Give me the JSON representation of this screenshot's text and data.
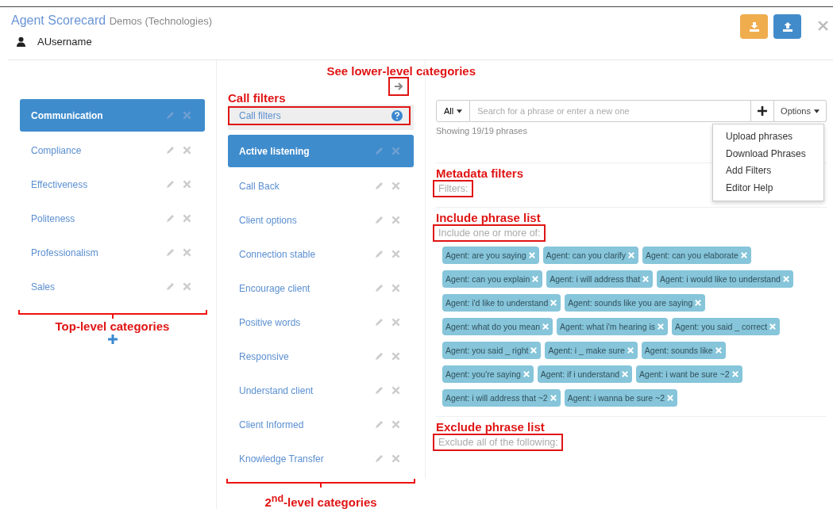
{
  "header": {
    "title": "Agent Scorecard",
    "subtitle": "Demos (Technologies)",
    "user": "AUsername"
  },
  "top_categories": [
    {
      "label": "Communication",
      "selected": true
    },
    {
      "label": "Compliance",
      "selected": false
    },
    {
      "label": "Effectiveness",
      "selected": false
    },
    {
      "label": "Politeness",
      "selected": false
    },
    {
      "label": "Professionalism",
      "selected": false
    },
    {
      "label": "Sales",
      "selected": false
    }
  ],
  "call_filters": {
    "label": "Call filters"
  },
  "second_categories": [
    {
      "label": "Active listening",
      "selected": true
    },
    {
      "label": "Call Back",
      "selected": false
    },
    {
      "label": "Client options",
      "selected": false
    },
    {
      "label": "Connection stable",
      "selected": false
    },
    {
      "label": "Encourage client",
      "selected": false
    },
    {
      "label": "Positive words",
      "selected": false
    },
    {
      "label": "Responsive",
      "selected": false
    },
    {
      "label": "Understand client",
      "selected": false
    },
    {
      "label": "Client Informed",
      "selected": false
    },
    {
      "label": "Knowledge Transfer",
      "selected": false
    }
  ],
  "search": {
    "scope": "All",
    "placeholder": "Search for a phrase or enter a new one",
    "options": "Options"
  },
  "count": "Showing 19/19 phrases",
  "options_menu": [
    "Upload phrases",
    "Download Phrases",
    "Add Filters",
    "Editor Help"
  ],
  "filters_label": "Filters:",
  "include_label": "Include one or more of:",
  "phrases": [
    "Agent: are you saying",
    "Agent: can you clarify",
    "Agent: can you elaborate",
    "Agent: can you explain",
    "Agent: i will address that",
    "Agent: i would like to understand",
    "Agent: i'd like to understand",
    "Agent: sounds like you are saying",
    "Agent: what do you mean",
    "Agent: what i'm hearing is",
    "Agent: you said _ correct",
    "Agent: you said _ right",
    "Agent: i _ make sure",
    "Agent: sounds like",
    "Agent: you're saying",
    "Agent: if i understand",
    "Agent: i want be sure ~2",
    "Agent: i will address that ~2",
    "Agent: i wanna be sure ~2"
  ],
  "exclude_label": "Exclude all of the following:",
  "annotations": {
    "lower_level": "See lower-level categories",
    "call_filters": "Call filters",
    "metadata": "Metadata filters",
    "include": "Include phrase list",
    "exclude": "Exclude phrase list",
    "top_level": "Top-level categories",
    "second_level": "2$^{nd}$-level categories"
  }
}
